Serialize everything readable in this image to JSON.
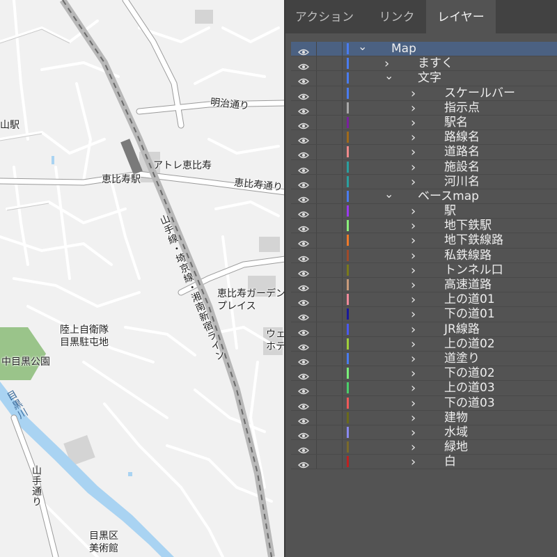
{
  "map": {
    "labels": [
      {
        "id": "map-label-yama-station",
        "text": "山駅"
      },
      {
        "id": "map-label-meiji-dori",
        "text": "明治通り"
      },
      {
        "id": "map-label-atre",
        "text": "アトレ恵比寿"
      },
      {
        "id": "map-label-ebisu-station",
        "text": "恵比寿駅"
      },
      {
        "id": "map-label-ebisu-dori",
        "text": "恵比寿通り"
      },
      {
        "id": "map-label-yamanote-line",
        "text": "山手線・埼京線・湘南新宿ライン"
      },
      {
        "id": "map-label-garden-place-1",
        "text": "恵比寿ガーデン"
      },
      {
        "id": "map-label-garden-place-2",
        "text": "プレイス"
      },
      {
        "id": "map-label-westin-1",
        "text": "ウェ"
      },
      {
        "id": "map-label-westin-2",
        "text": "ホテ"
      },
      {
        "id": "map-label-jsdf-1",
        "text": "陸上自衛隊"
      },
      {
        "id": "map-label-jsdf-2",
        "text": "目黒駐屯地"
      },
      {
        "id": "map-label-naka-meguro-park",
        "text": "中目黒公園"
      },
      {
        "id": "map-label-meguro-river",
        "text": "目黒川"
      },
      {
        "id": "map-label-yamate-dori",
        "text": "山手通り"
      },
      {
        "id": "map-label-museum-1",
        "text": "目黒区"
      },
      {
        "id": "map-label-museum-2",
        "text": "美術館"
      }
    ]
  },
  "panel": {
    "tabs": [
      "アクション",
      "リンク",
      "レイヤー"
    ],
    "active_tab": "レイヤー",
    "layers": [
      {
        "name": "Map",
        "depth": 0,
        "expanded": true,
        "color": "#4a7cf0",
        "selected": true
      },
      {
        "name": "ますく",
        "depth": 1,
        "expanded": false,
        "color": "#4a7cf0"
      },
      {
        "name": "文字",
        "depth": 1,
        "expanded": true,
        "color": "#4a7cf0"
      },
      {
        "name": "スケールバー",
        "depth": 2,
        "expanded": false,
        "color": "#4a7cf0"
      },
      {
        "name": "指示点",
        "depth": 2,
        "expanded": false,
        "color": "#a8a8a8"
      },
      {
        "name": "駅名",
        "depth": 2,
        "expanded": false,
        "color": "#7a1fa0"
      },
      {
        "name": "路線名",
        "depth": 2,
        "expanded": false,
        "color": "#a06a1a"
      },
      {
        "name": "道路名",
        "depth": 2,
        "expanded": false,
        "color": "#f08a8a"
      },
      {
        "name": "施設名",
        "depth": 2,
        "expanded": false,
        "color": "#2aa0a0"
      },
      {
        "name": "河川名",
        "depth": 2,
        "expanded": false,
        "color": "#2aa0a0"
      },
      {
        "name": "ベースmap",
        "depth": 1,
        "expanded": true,
        "color": "#4a7cf0"
      },
      {
        "name": "駅",
        "depth": 2,
        "expanded": false,
        "color": "#9a3af0"
      },
      {
        "name": "地下鉄駅",
        "depth": 2,
        "expanded": false,
        "color": "#8af07a"
      },
      {
        "name": "地下鉄線路",
        "depth": 2,
        "expanded": false,
        "color": "#f07a2a"
      },
      {
        "name": "私鉄線路",
        "depth": 2,
        "expanded": false,
        "color": "#a04a2a"
      },
      {
        "name": "トンネル口",
        "depth": 2,
        "expanded": false,
        "color": "#7a7a1a"
      },
      {
        "name": "高速道路",
        "depth": 2,
        "expanded": false,
        "color": "#c89a7a"
      },
      {
        "name": "上の道01",
        "depth": 2,
        "expanded": false,
        "color": "#f08a9a"
      },
      {
        "name": "下の道01",
        "depth": 2,
        "expanded": false,
        "color": "#1a1a9a"
      },
      {
        "name": "JR線路",
        "depth": 2,
        "expanded": false,
        "color": "#4a5af0"
      },
      {
        "name": "上の道02",
        "depth": 2,
        "expanded": false,
        "color": "#a0d03a"
      },
      {
        "name": "道塗り",
        "depth": 2,
        "expanded": false,
        "color": "#4a7cf0"
      },
      {
        "name": "下の道02",
        "depth": 2,
        "expanded": false,
        "color": "#7af07a"
      },
      {
        "name": "上の道03",
        "depth": 2,
        "expanded": false,
        "color": "#4ad06a"
      },
      {
        "name": "下の道03",
        "depth": 2,
        "expanded": false,
        "color": "#f05a5a"
      },
      {
        "name": "建物",
        "depth": 2,
        "expanded": false,
        "color": "#6a6a1a"
      },
      {
        "name": "水域",
        "depth": 2,
        "expanded": false,
        "color": "#8a8af0"
      },
      {
        "name": "緑地",
        "depth": 2,
        "expanded": false,
        "color": "#7a6a2a"
      },
      {
        "name": "白",
        "depth": 2,
        "expanded": false,
        "color": "#c02020"
      }
    ]
  }
}
